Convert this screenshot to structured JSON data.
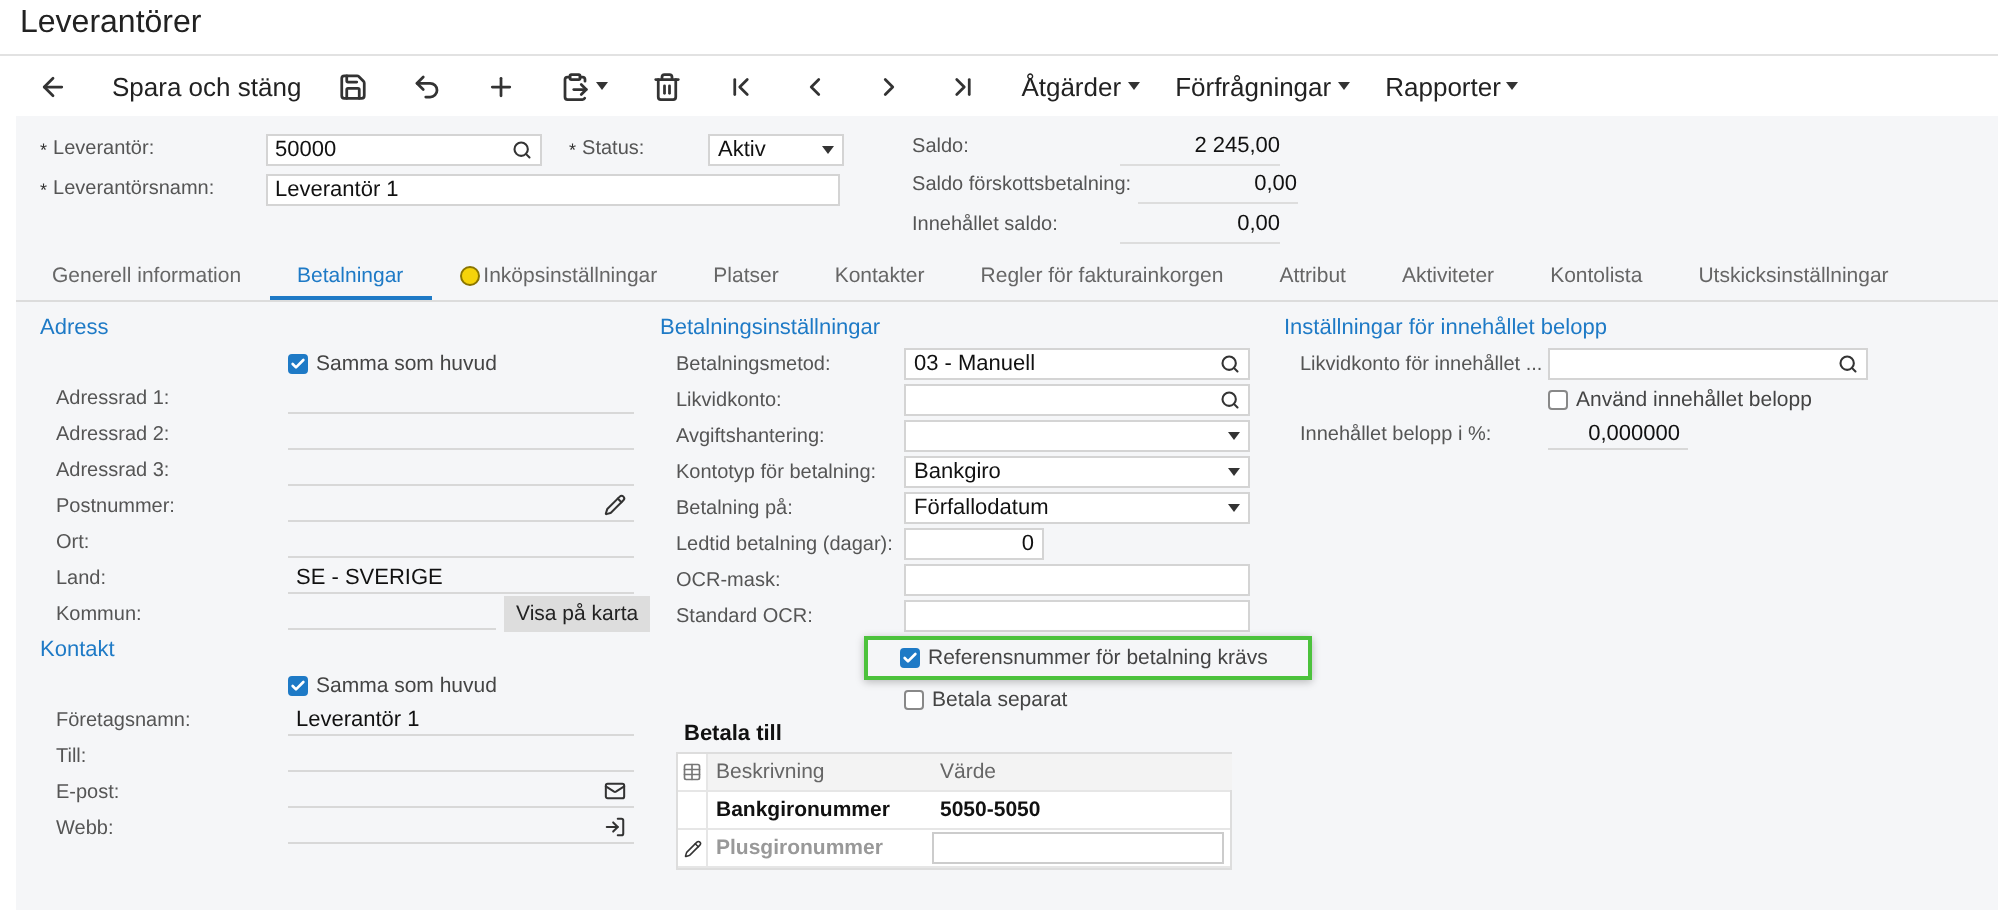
{
  "title": "Leverantörer",
  "toolbar": [
    {
      "kind": "icon"
    },
    {
      "kind": "text",
      "label": "Spara och stäng"
    },
    {
      "kind": "icon"
    },
    {
      "kind": "icon"
    },
    {
      "kind": "icon"
    },
    {
      "kind": "icon",
      "menu": true
    },
    {
      "kind": "icon"
    },
    {
      "kind": "icon"
    },
    {
      "kind": "icon"
    },
    {
      "kind": "icon"
    },
    {
      "kind": "icon"
    },
    {
      "kind": "text",
      "label": "Åtgärder",
      "menu": true
    },
    {
      "kind": "text",
      "label": "Förfrågningar",
      "menu": true
    },
    {
      "kind": "text",
      "label": "Rapporter",
      "menu": true
    }
  ],
  "header": {
    "fields": [
      {
        "label": "Leverantör:",
        "marker": "*",
        "kind": "lookup",
        "value": "50000"
      },
      {
        "label": "Leverantörsnamn:",
        "marker": "*",
        "kind": "text",
        "value": "Leverantör 1"
      }
    ],
    "status": {
      "label": "Status:",
      "marker": "*",
      "value": "Aktiv"
    },
    "summary": [
      {
        "label": "Saldo:",
        "value": "2 245,00"
      },
      {
        "label": "Saldo förskottsbetalning:",
        "value": "0,00"
      },
      {
        "label": "Innehållet saldo:",
        "value": "0,00"
      }
    ]
  },
  "tabs": [
    {
      "label": "Generell information",
      "selected": false,
      "warning": false
    },
    {
      "label": "Betalningar",
      "selected": true,
      "warning": false
    },
    {
      "label": "Inköpsinställningar",
      "selected": false,
      "warning": true
    },
    {
      "label": "Platser",
      "selected": false,
      "warning": false
    },
    {
      "label": "Kontakter",
      "selected": false,
      "warning": false
    },
    {
      "label": "Regler för fakturainkorgen",
      "selected": false,
      "warning": false
    },
    {
      "label": "Attribut",
      "selected": false,
      "warning": false
    },
    {
      "label": "Aktiviteter",
      "selected": false,
      "warning": false
    },
    {
      "label": "Kontolista",
      "selected": false,
      "warning": false
    },
    {
      "label": "Utskicksinställningar",
      "selected": false,
      "warning": false
    }
  ],
  "address": {
    "title": "Adress",
    "rows": [
      {
        "kind": "check",
        "label": "Samma som huvud",
        "checked": true
      },
      {
        "kind": "line",
        "label": "Adressrad 1:"
      },
      {
        "kind": "line",
        "label": "Adressrad 2:"
      },
      {
        "kind": "line",
        "label": "Adressrad 3:"
      },
      {
        "kind": "postcode",
        "label": "Postnummer:"
      },
      {
        "kind": "line",
        "label": "Ort:"
      },
      {
        "kind": "line",
        "label": "Land:",
        "value": "SE - SVERIGE"
      },
      {
        "kind": "map",
        "label": "Kommun:",
        "button": "Visa på karta"
      }
    ]
  },
  "contact": {
    "title": "Kontakt",
    "rows": [
      {
        "kind": "check",
        "label": "Samma som huvud",
        "checked": true
      },
      {
        "kind": "line",
        "label": "Företagsnamn:",
        "value": "Leverantör 1"
      },
      {
        "kind": "line",
        "label": "Till:"
      },
      {
        "kind": "email",
        "label": "E-post:"
      },
      {
        "kind": "url",
        "label": "Webb:"
      }
    ]
  },
  "payment": {
    "title": "Betalningsinställningar",
    "rows": [
      {
        "kind": "lookup",
        "label": "Betalningsmetod:",
        "value": "03 - Manuell"
      },
      {
        "kind": "lookup",
        "label": "Likvidkonto:"
      },
      {
        "kind": "select",
        "label": "Avgiftshantering:"
      },
      {
        "kind": "select",
        "label": "Kontotyp för betalning:",
        "value": "Bankgiro"
      },
      {
        "kind": "select",
        "label": "Betalning på:",
        "value": "Förfallodatum"
      },
      {
        "kind": "number",
        "label": "Ledtid betalning (dagar):",
        "value": "0"
      },
      {
        "kind": "box",
        "label": "OCR-mask:"
      },
      {
        "kind": "box",
        "label": "Standard OCR:"
      },
      {
        "kind": "check",
        "label": "Referensnummer för betalning krävs",
        "checked": true,
        "highlighted": true
      },
      {
        "kind": "check",
        "label": "Betala separat",
        "checked": false,
        "highlighted": false
      }
    ]
  },
  "pay_to": {
    "title": "Betala till",
    "columns": [
      "Beskrivning",
      "Värde"
    ],
    "rows": [
      {
        "description": "Bankgironummer",
        "value": "5050-5050",
        "new": false
      },
      {
        "description": "Plusgironummer",
        "new": true
      }
    ]
  },
  "withholding": {
    "title": "Inställningar för innehållet belopp",
    "rows": [
      {
        "kind": "lookup",
        "label": "Likvidkonto för innehållet ..."
      },
      {
        "kind": "check",
        "label": "Använd innehållet belopp",
        "checked": false
      },
      {
        "kind": "numline",
        "label": "Innehållet belopp i %:",
        "value": "0,000000"
      }
    ]
  }
}
